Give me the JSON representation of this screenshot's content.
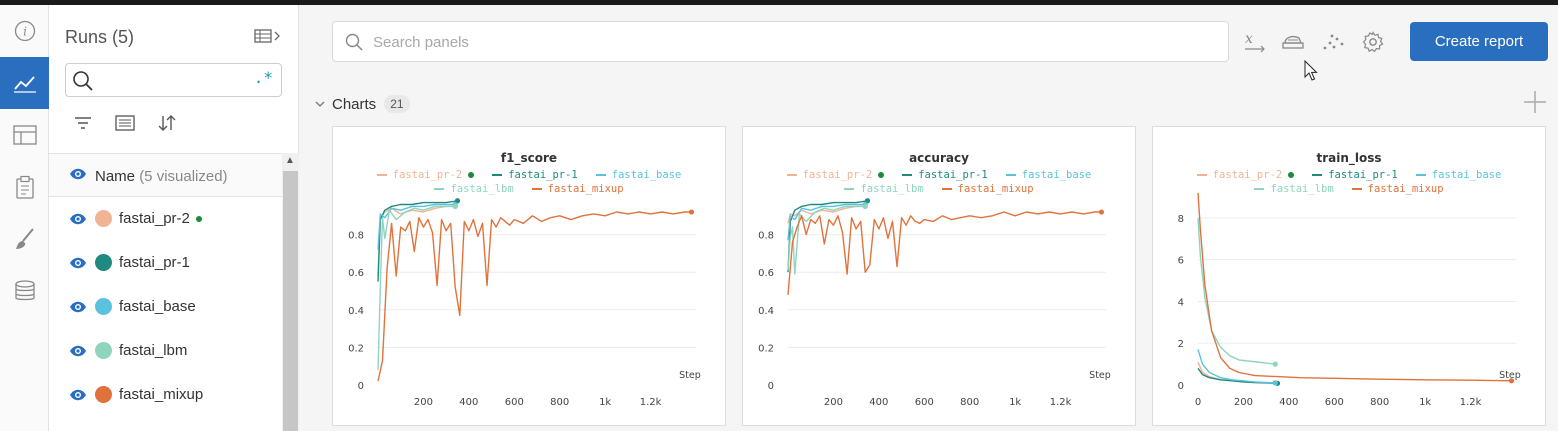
{
  "colors": {
    "accent": "#2a6fbf",
    "live": "#1b8a3b",
    "fastai_pr-2": "#f0b493",
    "fastai_pr-1": "#1f8a80",
    "fastai_base": "#5bc2de",
    "fastai_lbm": "#8fd5be",
    "fastai_mixup": "#e0733b"
  },
  "rail": [
    {
      "icon": "info-icon",
      "active": false
    },
    {
      "icon": "line-chart-icon",
      "active": true
    },
    {
      "icon": "table-icon",
      "active": false
    },
    {
      "icon": "clipboard-icon",
      "active": false
    },
    {
      "icon": "brush-icon",
      "active": false
    },
    {
      "icon": "database-icon",
      "active": false
    }
  ],
  "runs": {
    "title": "Runs (5)",
    "search_value": "",
    "regex_label": ".*",
    "name_header": "Name",
    "visualized": "(5 visualized)",
    "items": [
      {
        "name": "fastai_pr-2",
        "color": "#f0b493",
        "live": true
      },
      {
        "name": "fastai_pr-1",
        "color": "#1f8a80",
        "live": false
      },
      {
        "name": "fastai_base",
        "color": "#5bc2de",
        "live": false
      },
      {
        "name": "fastai_lbm",
        "color": "#8fd5be",
        "live": false
      },
      {
        "name": "fastai_mixup",
        "color": "#e0733b",
        "live": false
      }
    ]
  },
  "header": {
    "search_placeholder": "Search panels",
    "create_report": "Create report",
    "icons": [
      "x-axis-icon",
      "smoothing-icon",
      "outliers-icon",
      "settings-icon"
    ]
  },
  "section": {
    "title": "Charts",
    "count": "21"
  },
  "chart_data": [
    {
      "type": "line",
      "title": "f1_score",
      "xlabel": "Step",
      "ylabel": "",
      "xlim": [
        0,
        1400
      ],
      "ylim": [
        0,
        1.0
      ],
      "xticks": [
        200,
        400,
        600,
        800,
        1000,
        1200
      ],
      "xtick_labels": [
        "200",
        "400",
        "600",
        "800",
        "1k",
        "1.2k"
      ],
      "yticks": [
        0,
        0.2,
        0.4,
        0.6,
        0.8
      ],
      "ytick_labels": [
        "0",
        "0.2",
        "0.4",
        "0.6",
        "0.8"
      ],
      "grid": true,
      "legend": [
        "fastai_pr-2",
        "fastai_pr-1",
        "fastai_base",
        "fastai_lbm",
        "fastai_mixup"
      ],
      "series": [
        {
          "name": "fastai_pr-2",
          "x": [
            0,
            10,
            30,
            60,
            100,
            150,
            200,
            250,
            300,
            340
          ],
          "y": [
            0.58,
            0.89,
            0.92,
            0.94,
            0.91,
            0.93,
            0.92,
            0.94,
            0.95,
            0.95
          ]
        },
        {
          "name": "fastai_pr-1",
          "x": [
            0,
            10,
            30,
            60,
            100,
            150,
            200,
            250,
            300,
            350
          ],
          "y": [
            0.55,
            0.88,
            0.93,
            0.95,
            0.96,
            0.96,
            0.97,
            0.97,
            0.97,
            0.98
          ]
        },
        {
          "name": "fastai_base",
          "x": [
            0,
            10,
            30,
            60,
            100,
            150,
            200,
            250,
            300,
            340
          ],
          "y": [
            0.72,
            0.91,
            0.89,
            0.94,
            0.93,
            0.95,
            0.95,
            0.96,
            0.96,
            0.96
          ]
        },
        {
          "name": "fastai_lbm",
          "x": [
            0,
            10,
            20,
            30,
            50,
            80,
            120,
            160,
            200,
            250,
            300,
            340
          ],
          "y": [
            0.08,
            0.52,
            0.89,
            0.78,
            0.93,
            0.88,
            0.92,
            0.94,
            0.93,
            0.95,
            0.95,
            0.95
          ]
        },
        {
          "name": "fastai_mixup",
          "x": [
            0,
            20,
            40,
            60,
            80,
            100,
            120,
            140,
            160,
            180,
            200,
            220,
            240,
            260,
            280,
            300,
            320,
            340,
            360,
            380,
            400,
            420,
            440,
            460,
            480,
            500,
            520,
            540,
            560,
            580,
            600,
            640,
            680,
            720,
            760,
            800,
            850,
            900,
            950,
            1000,
            1050,
            1100,
            1150,
            1200,
            1250,
            1300,
            1350,
            1380
          ],
          "y": [
            0.02,
            0.13,
            0.62,
            0.86,
            0.58,
            0.84,
            0.82,
            0.87,
            0.71,
            0.89,
            0.84,
            0.88,
            0.81,
            0.53,
            0.88,
            0.82,
            0.86,
            0.52,
            0.37,
            0.87,
            0.82,
            0.88,
            0.79,
            0.86,
            0.53,
            0.88,
            0.84,
            0.89,
            0.87,
            0.85,
            0.88,
            0.86,
            0.9,
            0.87,
            0.89,
            0.9,
            0.88,
            0.9,
            0.91,
            0.9,
            0.92,
            0.91,
            0.92,
            0.91,
            0.92,
            0.91,
            0.92,
            0.92
          ]
        }
      ]
    },
    {
      "type": "line",
      "title": "accuracy",
      "xlabel": "Step",
      "ylabel": "",
      "xlim": [
        0,
        1400
      ],
      "ylim": [
        0,
        1.0
      ],
      "xticks": [
        200,
        400,
        600,
        800,
        1000,
        1200
      ],
      "xtick_labels": [
        "200",
        "400",
        "600",
        "800",
        "1k",
        "1.2k"
      ],
      "yticks": [
        0,
        0.2,
        0.4,
        0.6,
        0.8
      ],
      "ytick_labels": [
        "0",
        "0.2",
        "0.4",
        "0.6",
        "0.8"
      ],
      "grid": true,
      "legend": [
        "fastai_pr-2",
        "fastai_pr-1",
        "fastai_base",
        "fastai_lbm",
        "fastai_mixup"
      ],
      "series": [
        {
          "name": "fastai_pr-2",
          "x": [
            0,
            10,
            30,
            60,
            100,
            150,
            200,
            250,
            300,
            340
          ],
          "y": [
            0.86,
            0.91,
            0.9,
            0.93,
            0.91,
            0.93,
            0.92,
            0.94,
            0.95,
            0.95
          ]
        },
        {
          "name": "fastai_pr-1",
          "x": [
            0,
            10,
            30,
            60,
            100,
            150,
            200,
            250,
            300,
            350
          ],
          "y": [
            0.6,
            0.87,
            0.93,
            0.95,
            0.96,
            0.96,
            0.97,
            0.97,
            0.97,
            0.98
          ]
        },
        {
          "name": "fastai_base",
          "x": [
            0,
            10,
            30,
            60,
            100,
            150,
            200,
            250,
            300,
            340
          ],
          "y": [
            0.77,
            0.9,
            0.88,
            0.94,
            0.93,
            0.95,
            0.95,
            0.96,
            0.96,
            0.96
          ]
        },
        {
          "name": "fastai_lbm",
          "x": [
            0,
            10,
            20,
            30,
            50,
            80,
            120,
            160,
            200,
            250,
            300,
            340
          ],
          "y": [
            0.61,
            0.79,
            0.84,
            0.59,
            0.91,
            0.87,
            0.92,
            0.94,
            0.93,
            0.95,
            0.95,
            0.95
          ]
        },
        {
          "name": "fastai_mixup",
          "x": [
            0,
            20,
            40,
            60,
            80,
            100,
            120,
            140,
            160,
            180,
            200,
            220,
            240,
            260,
            280,
            300,
            320,
            340,
            360,
            380,
            400,
            420,
            440,
            460,
            480,
            500,
            520,
            540,
            560,
            580,
            600,
            640,
            680,
            720,
            760,
            800,
            850,
            900,
            950,
            1000,
            1050,
            1100,
            1150,
            1200,
            1250,
            1300,
            1350,
            1380
          ],
          "y": [
            0.48,
            0.76,
            0.84,
            0.9,
            0.8,
            0.88,
            0.86,
            0.9,
            0.75,
            0.88,
            0.85,
            0.9,
            0.81,
            0.59,
            0.89,
            0.83,
            0.87,
            0.6,
            0.64,
            0.88,
            0.83,
            0.89,
            0.78,
            0.87,
            0.63,
            0.89,
            0.85,
            0.9,
            0.87,
            0.86,
            0.88,
            0.87,
            0.9,
            0.88,
            0.89,
            0.9,
            0.89,
            0.9,
            0.92,
            0.9,
            0.92,
            0.91,
            0.92,
            0.91,
            0.92,
            0.91,
            0.92,
            0.92
          ]
        }
      ]
    },
    {
      "type": "line",
      "title": "train_loss",
      "xlabel": "Step",
      "ylabel": "",
      "xlim": [
        0,
        1400
      ],
      "ylim": [
        0,
        9
      ],
      "xticks": [
        0,
        200,
        400,
        600,
        800,
        1000,
        1200
      ],
      "xtick_labels": [
        "0",
        "200",
        "400",
        "600",
        "800",
        "1k",
        "1.2k"
      ],
      "yticks": [
        0,
        2,
        4,
        6,
        8
      ],
      "ytick_labels": [
        "0",
        "2",
        "4",
        "6",
        "8"
      ],
      "grid": true,
      "legend": [
        "fastai_pr-2",
        "fastai_pr-1",
        "fastai_base",
        "fastai_lbm",
        "fastai_mixup"
      ],
      "series": [
        {
          "name": "fastai_pr-2",
          "x": [
            0,
            20,
            50,
            100,
            150,
            200,
            250,
            300,
            340
          ],
          "y": [
            1.1,
            0.6,
            0.4,
            0.25,
            0.2,
            0.15,
            0.12,
            0.1,
            0.1
          ]
        },
        {
          "name": "fastai_pr-1",
          "x": [
            0,
            20,
            50,
            100,
            150,
            200,
            250,
            300,
            350
          ],
          "y": [
            0.8,
            0.5,
            0.35,
            0.25,
            0.2,
            0.15,
            0.12,
            0.1,
            0.08
          ]
        },
        {
          "name": "fastai_base",
          "x": [
            0,
            20,
            50,
            100,
            150,
            200,
            250,
            300,
            340
          ],
          "y": [
            1.7,
            1.0,
            0.6,
            0.35,
            0.25,
            0.2,
            0.15,
            0.12,
            0.1
          ]
        },
        {
          "name": "fastai_lbm",
          "x": [
            0,
            10,
            30,
            60,
            100,
            140,
            180,
            220,
            260,
            300,
            340
          ],
          "y": [
            8.0,
            6.2,
            4.2,
            2.6,
            1.8,
            1.4,
            1.2,
            1.15,
            1.1,
            1.05,
            1.0
          ]
        },
        {
          "name": "fastai_mixup",
          "x": [
            0,
            10,
            30,
            60,
            100,
            140,
            180,
            250,
            350,
            450,
            600,
            800,
            1000,
            1200,
            1380
          ],
          "y": [
            9.2,
            7.5,
            4.8,
            2.6,
            1.3,
            0.8,
            0.6,
            0.45,
            0.4,
            0.35,
            0.32,
            0.28,
            0.25,
            0.23,
            0.2
          ]
        }
      ]
    }
  ]
}
